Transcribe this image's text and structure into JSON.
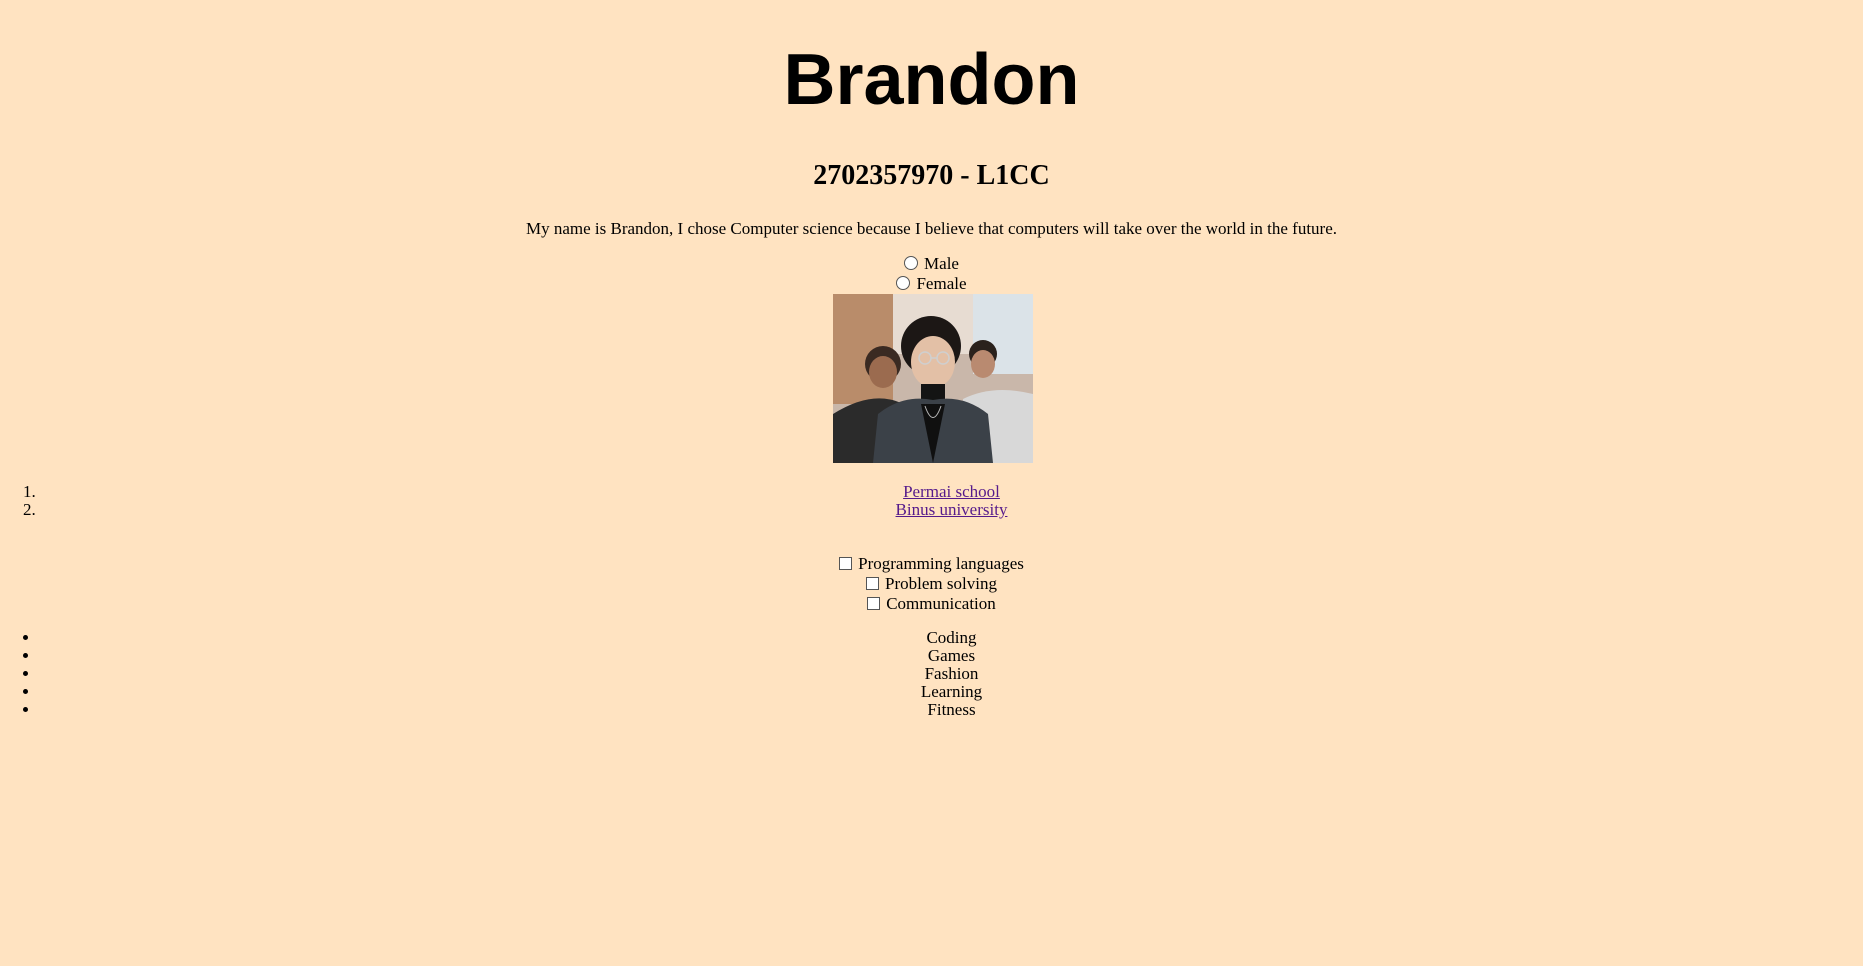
{
  "header": {
    "name": "Brandon",
    "subtitle": "2702357970 - L1CC"
  },
  "intro": {
    "text": "My name is Brandon, I chose Computer science because I believe that computers will take over the world in the future."
  },
  "gender": {
    "options": [
      "Male",
      "Female"
    ]
  },
  "photo": {
    "alt": "Brandon"
  },
  "education": {
    "items": [
      "Permai school",
      "Binus university"
    ]
  },
  "skills": {
    "items": [
      "Programming languages",
      "Problem solving",
      "Communication"
    ]
  },
  "hobbies": {
    "items": [
      "Coding",
      "Games",
      "Fashion",
      "Learning",
      "Fitness"
    ]
  },
  "colors": {
    "background": "#ffe3c1",
    "visited_link": "#551a8b"
  }
}
